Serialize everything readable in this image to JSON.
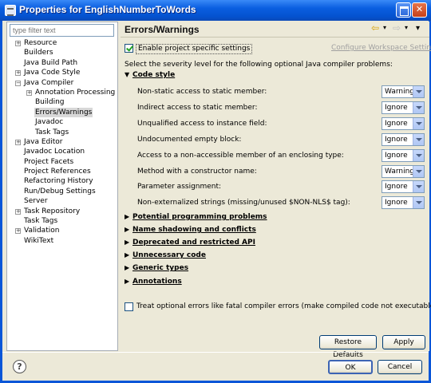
{
  "window": {
    "title": "Properties for EnglishNumberToWords"
  },
  "filter": {
    "placeholder": "type filter text"
  },
  "tree": [
    {
      "label": "Resource",
      "exp": "+",
      "indent": 0
    },
    {
      "label": "Builders",
      "exp": "",
      "indent": 0
    },
    {
      "label": "Java Build Path",
      "exp": "",
      "indent": 0
    },
    {
      "label": "Java Code Style",
      "exp": "+",
      "indent": 0
    },
    {
      "label": "Java Compiler",
      "exp": "−",
      "indent": 0
    },
    {
      "label": "Annotation Processing",
      "exp": "+",
      "indent": 1
    },
    {
      "label": "Building",
      "exp": "",
      "indent": 1
    },
    {
      "label": "Errors/Warnings",
      "exp": "",
      "indent": 1,
      "selected": true
    },
    {
      "label": "Javadoc",
      "exp": "",
      "indent": 1
    },
    {
      "label": "Task Tags",
      "exp": "",
      "indent": 1
    },
    {
      "label": "Java Editor",
      "exp": "+",
      "indent": 0
    },
    {
      "label": "Javadoc Location",
      "exp": "",
      "indent": 0
    },
    {
      "label": "Project Facets",
      "exp": "",
      "indent": 0
    },
    {
      "label": "Project References",
      "exp": "",
      "indent": 0
    },
    {
      "label": "Refactoring History",
      "exp": "",
      "indent": 0
    },
    {
      "label": "Run/Debug Settings",
      "exp": "",
      "indent": 0
    },
    {
      "label": "Server",
      "exp": "",
      "indent": 0
    },
    {
      "label": "Task Repository",
      "exp": "+",
      "indent": 0
    },
    {
      "label": "Task Tags",
      "exp": "",
      "indent": 0
    },
    {
      "label": "Validation",
      "exp": "+",
      "indent": 0
    },
    {
      "label": "WikiText",
      "exp": "",
      "indent": 0
    }
  ],
  "page": {
    "title": "Errors/Warnings",
    "enable_label": "Enable project specific settings",
    "configure_link": "Configure Workspace Settings...",
    "severity_text": "Select the severity level for the following optional Java compiler problems:",
    "code_style_title": "Code style",
    "code_style_rows": [
      {
        "label": "Non-static access to static member:",
        "value": "Warning"
      },
      {
        "label": "Indirect access to static member:",
        "value": "Ignore"
      },
      {
        "label": "Unqualified access to instance field:",
        "value": "Ignore"
      },
      {
        "label": "Undocumented empty block:",
        "value": "Ignore"
      },
      {
        "label": "Access to a non-accessible member of an enclosing type:",
        "value": "Ignore"
      },
      {
        "label": "Method with a constructor name:",
        "value": "Warning"
      },
      {
        "label": "Parameter assignment:",
        "value": "Ignore"
      },
      {
        "label": "Non-externalized strings (missing/unused $NON-NLS$ tag):",
        "value": "Ignore"
      }
    ],
    "collapsed_sections": [
      "Potential programming problems",
      "Name shadowing and conflicts",
      "Deprecated and restricted API",
      "Unnecessary code",
      "Generic types",
      "Annotations"
    ],
    "treat_label": "Treat optional errors like fatal compiler errors (make compiled code not executable)",
    "restore_defaults": "Restore Defaults",
    "apply": "Apply"
  },
  "buttons": {
    "ok": "OK",
    "cancel": "Cancel"
  },
  "icons": {
    "help": "?",
    "back_arrow": "⇦",
    "forward_arrow": "⇨",
    "menu": "▾"
  }
}
